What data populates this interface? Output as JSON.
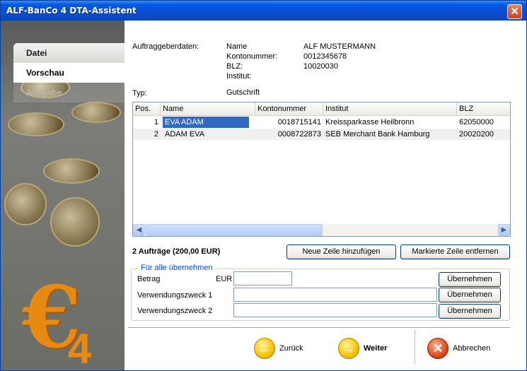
{
  "window": {
    "title": "ALF-BanCo 4 DTA-Assistent",
    "close_icon": "close-icon"
  },
  "nav": {
    "items": [
      {
        "label": "Datei"
      },
      {
        "label": "Vorschau"
      },
      {
        "label": "Ausgabe"
      }
    ]
  },
  "logo": {
    "euro": "€",
    "digit": "4"
  },
  "auftraggeber": {
    "section_label": "Auftraggeberdaten:",
    "name_label": "Name",
    "name_value": "ALF MUSTERMANN",
    "konto_label": "Kontonummer:",
    "konto_value": "0012345678",
    "blz_label": "BLZ:",
    "blz_value": "10020030",
    "institut_label": "Institut:",
    "typ_label": "Typ:",
    "typ_value": "Gutschrift"
  },
  "table": {
    "columns": [
      "Pos.",
      "Name",
      "Kontonummer",
      "Institut",
      "BLZ"
    ],
    "rows": [
      {
        "pos": "1",
        "name": "EVA ADAM",
        "konto": "0018715141",
        "institut": "Kreissparkasse Heilbronn",
        "blz": "62050000"
      },
      {
        "pos": "2",
        "name": "ADAM EVA",
        "konto": "0008722873",
        "institut": "SEB Merchant Bank Hamburg",
        "blz": "20020200"
      }
    ]
  },
  "summary": "2 Aufträge (200,00 EUR)",
  "buttons": {
    "add_row": "Neue Zeile hinzufügen",
    "remove_row": "Markierte Zeile entfernen",
    "apply": "Übernehmen"
  },
  "group": {
    "title": "Für alle übernehmen",
    "betrag_label": "Betrag",
    "currency": "EUR",
    "vz1_label": "Verwendungszweck 1",
    "vz2_label": "Verwendungszweck 2"
  },
  "footer": {
    "back": "Zurück",
    "next": "Weiter",
    "cancel": "Abbrechen"
  }
}
